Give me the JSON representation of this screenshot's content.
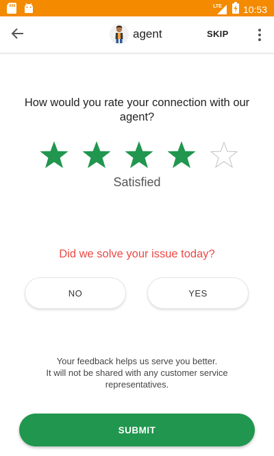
{
  "status_bar": {
    "time": "10:53",
    "network": "LTE",
    "icons": [
      "sd-card-icon",
      "android-icon",
      "signal-icon",
      "battery-icon"
    ]
  },
  "app_bar": {
    "agent_name": "agent",
    "skip_label": "SKIP",
    "icons": [
      "back-arrow-icon",
      "avatar",
      "more-vert-icon"
    ]
  },
  "rating": {
    "question": "How would you rate your connection with our agent?",
    "stars_total": 5,
    "stars_filled": 4,
    "label": "Satisfied",
    "star_color": "#21964f"
  },
  "issue": {
    "question": "Did we solve your issue today?",
    "no_label": "NO",
    "yes_label": "YES",
    "question_color": "#ea4a45"
  },
  "feedback_note": {
    "line1": "Your feedback helps us serve you better.",
    "line2": "It will not be shared with any customer service representatives."
  },
  "submit": {
    "label": "SUBMIT",
    "color": "#21964f"
  },
  "colors": {
    "status_bar": "#f48a00"
  }
}
